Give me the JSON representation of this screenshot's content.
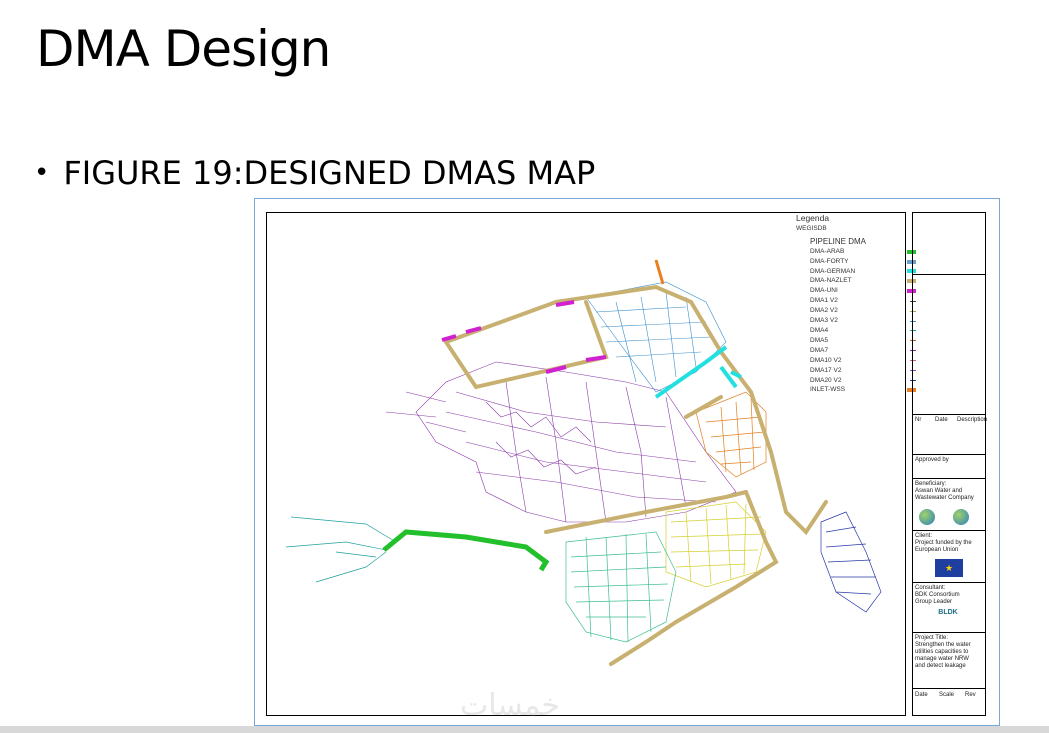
{
  "slide": {
    "title": "DMA Design",
    "bullet": "FIGURE 19:DESIGNED  DMAS MAP"
  },
  "legend": {
    "heading": "Legenda",
    "source": "WEGISDB",
    "group": "PIPELINE DMA",
    "items": [
      {
        "label": "DMA-ARAB",
        "color": "#22c02a",
        "style": "swatch"
      },
      {
        "label": "DMA-FORTY",
        "color": "#6a9ecf",
        "style": "swatch"
      },
      {
        "label": "DMA-GERMAN",
        "color": "#22e0e0",
        "style": "swatch"
      },
      {
        "label": "DMA-NAZLET",
        "color": "#c8b070",
        "style": "swatch"
      },
      {
        "label": "DMA-UNI",
        "color": "#d020d0",
        "style": "swatch"
      },
      {
        "label": "DMA1 V2",
        "color": "#444444",
        "style": "line"
      },
      {
        "label": "DMA2 V2",
        "color": "#b0a040",
        "style": "line"
      },
      {
        "label": "DMA3 V2",
        "color": "#3090d0",
        "style": "line"
      },
      {
        "label": "DMA4",
        "color": "#20a0a0",
        "style": "line"
      },
      {
        "label": "DMA5",
        "color": "#c06020",
        "style": "line"
      },
      {
        "label": "DMA7",
        "color": "#8030a0",
        "style": "line"
      },
      {
        "label": "DMA10 V2",
        "color": "#d06080",
        "style": "line"
      },
      {
        "label": "DMA17 V2",
        "color": "#9040c0",
        "style": "line"
      },
      {
        "label": "DMA20 V2",
        "color": "#2040a0",
        "style": "line"
      },
      {
        "label": "INLET-WSS",
        "color": "#e88020",
        "style": "swatch"
      }
    ]
  },
  "titleblock": {
    "rev_headers": [
      "Nr",
      "Date",
      "Description"
    ],
    "approved": "Approved by",
    "beneficiary": "Beneficiary:\nAswan Water and\nWastewater Company",
    "client": "Client:\nProject funded by the\nEuropean Union",
    "consultant": "Consultant:\nBDK Consortium\nGroup Leader",
    "bldk": "BLDK",
    "project": "Project Title:\nStrengthen the water\nutilities capacities to\nmanage water NRW\nand detect leakage",
    "footer": [
      "Date",
      "Scale",
      "Rev"
    ]
  },
  "watermark": "خمسات"
}
